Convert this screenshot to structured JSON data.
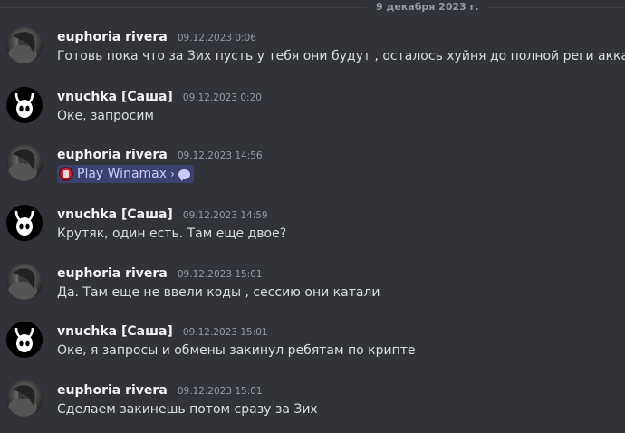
{
  "date_divider": "9 декабря 2023 г.",
  "messages": [
    {
      "author": "euphoria rivera",
      "timestamp": "09.12.2023 0:06",
      "avatar_icon": "photo-avatar",
      "content": "Готовь пока что за Зих пусть у тебя они будут , осталось хуйня до полной реги акка"
    },
    {
      "author": "vnuchka [Саша]",
      "timestamp": "09.12.2023 0:20",
      "avatar_icon": "hollow-knight-avatar",
      "content": "Оке, запросим"
    },
    {
      "author": "euphoria rivera",
      "timestamp": "09.12.2023 14:56",
      "avatar_icon": "photo-avatar",
      "mention": {
        "label": "Play Winamax",
        "chevron": "›",
        "icon": "winamax-icon",
        "thread_icon": "chat-bubble-icon"
      }
    },
    {
      "author": "vnuchka [Саша]",
      "timestamp": "09.12.2023 14:59",
      "avatar_icon": "hollow-knight-avatar",
      "content": "Крутяк, один есть. Там еще двое?"
    },
    {
      "author": "euphoria rivera",
      "timestamp": "09.12.2023 15:01",
      "avatar_icon": "photo-avatar",
      "content": "Да. Там еще не ввели коды , сессию они катали"
    },
    {
      "author": "vnuchka [Саша]",
      "timestamp": "09.12.2023 15:01",
      "avatar_icon": "hollow-knight-avatar",
      "content": "Оке, я запросы и обмены закинул ребятам по крипте"
    },
    {
      "author": "euphoria rivera",
      "timestamp": "09.12.2023 15:01",
      "avatar_icon": "photo-avatar",
      "content": "Сделаем закинешь потом сразу за Зих"
    }
  ],
  "colors": {
    "background": "#313338",
    "author": "#f2f3f5",
    "text": "#dbdee1",
    "muted": "#949ba4",
    "mention_bg": "#3c4270",
    "mention_text": "#c9cdfb"
  }
}
